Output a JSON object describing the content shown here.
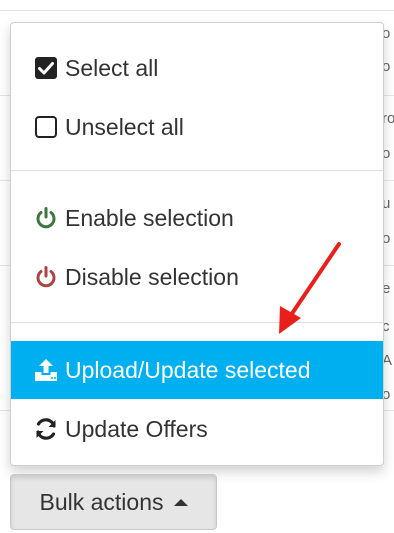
{
  "background": {
    "fragments": [
      "o",
      "o",
      "ro",
      "o",
      "u",
      "o",
      "e",
      "c",
      "A",
      "o"
    ]
  },
  "menu": {
    "items": [
      {
        "label": "Select all",
        "icon": "checkbox-checked-icon"
      },
      {
        "label": "Unselect all",
        "icon": "checkbox-empty-icon"
      },
      {
        "label": "Enable selection",
        "icon": "power-icon",
        "icon_color": "#3c763d"
      },
      {
        "label": "Disable selection",
        "icon": "power-icon",
        "icon_color": "#a94442"
      },
      {
        "label": "Upload/Update selected",
        "icon": "upload-icon",
        "active": true
      },
      {
        "label": "Update Offers",
        "icon": "refresh-icon"
      }
    ],
    "active_color": "#00aff0"
  },
  "bulk_button": {
    "label": "Bulk actions",
    "icon": "caret-up-icon"
  },
  "annotation": {
    "arrow_color": "#e8201c",
    "icon": "arrow-annotation-icon"
  }
}
